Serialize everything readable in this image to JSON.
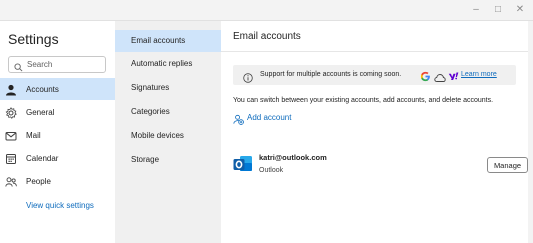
{
  "window": {
    "minimize_glyph": "–",
    "maximize_glyph": "□",
    "close_glyph": "✕"
  },
  "nav": {
    "title": "Settings",
    "search_placeholder": "Search",
    "items": [
      {
        "label": "Accounts",
        "icon": "person-icon",
        "active": true
      },
      {
        "label": "General",
        "icon": "gear-icon",
        "active": false
      },
      {
        "label": "Mail",
        "icon": "mail-icon",
        "active": false
      },
      {
        "label": "Calendar",
        "icon": "calendar-icon",
        "active": false
      },
      {
        "label": "People",
        "icon": "people-icon",
        "active": false
      }
    ],
    "quick_settings": "View quick settings"
  },
  "subnav": {
    "items": [
      {
        "label": "Email accounts",
        "active": true
      },
      {
        "label": "Automatic replies",
        "active": false
      },
      {
        "label": "Signatures",
        "active": false
      },
      {
        "label": "Categories",
        "active": false
      },
      {
        "label": "Mobile devices",
        "active": false
      },
      {
        "label": "Storage",
        "active": false
      }
    ]
  },
  "main": {
    "title": "Email accounts",
    "notice": {
      "text": "Support for multiple accounts is coming soon.",
      "learn_more": "Learn more",
      "provider_icons": [
        "google-icon",
        "icloud-icon",
        "yahoo-icon"
      ]
    },
    "description": "You can switch between your existing accounts, add accounts, and delete accounts.",
    "add_account": "Add account",
    "account": {
      "email": "katri@outlook.com",
      "type": "Outlook",
      "manage_label": "Manage"
    }
  },
  "colors": {
    "accent": "#0f6cbd",
    "selected_bg": "#cfe4fa",
    "outlook_blue": "#0078d4",
    "yahoo_purple": "#6001d2"
  }
}
